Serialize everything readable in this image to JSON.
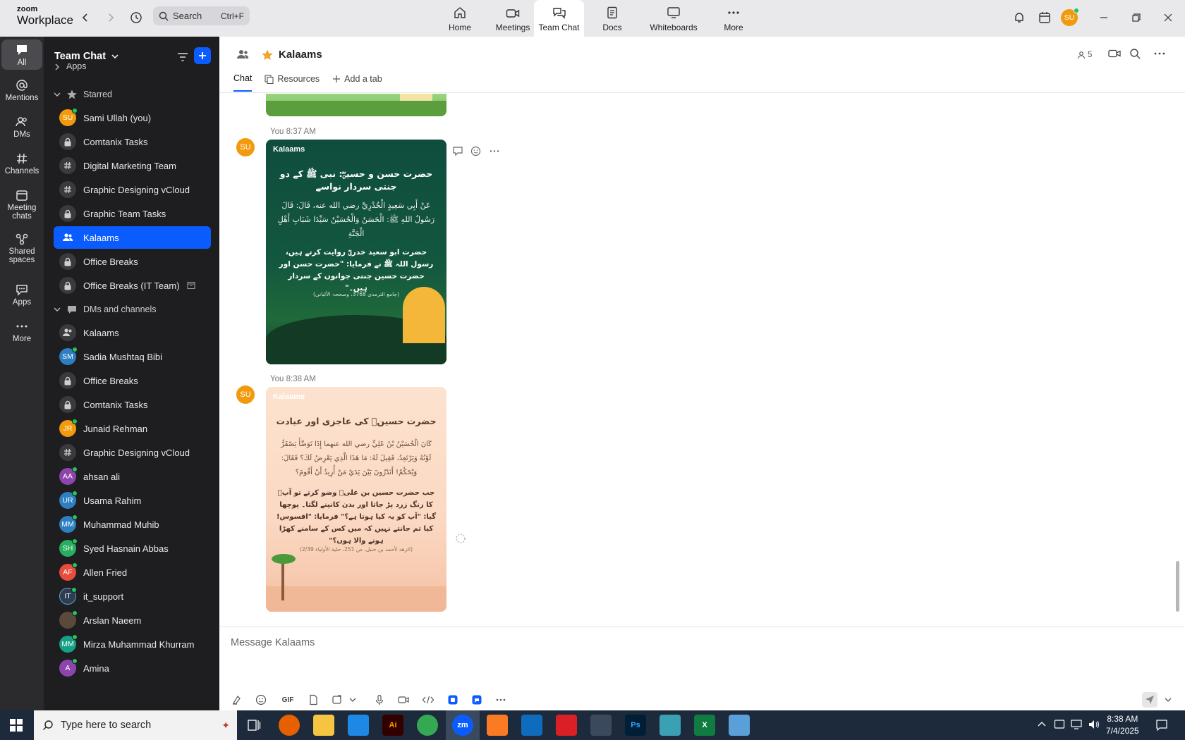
{
  "app": {
    "logo_line1": "zoom",
    "logo_line2": "Workplace"
  },
  "search": {
    "placeholder": "Search",
    "shortcut": "Ctrl+F"
  },
  "nav_tabs": [
    {
      "label": "Home",
      "icon": "home-icon"
    },
    {
      "label": "Meetings",
      "icon": "video-icon"
    },
    {
      "label": "Team Chat",
      "icon": "chat-icon",
      "active": true
    },
    {
      "label": "Docs",
      "icon": "doc-icon"
    },
    {
      "label": "Whiteboards",
      "icon": "whiteboard-icon"
    },
    {
      "label": "More",
      "icon": "more-icon"
    }
  ],
  "user": {
    "initials": "SU"
  },
  "rail": [
    {
      "label": "All",
      "icon": "chat-bubble-icon",
      "active": true
    },
    {
      "label": "Mentions",
      "icon": "at-icon"
    },
    {
      "label": "DMs",
      "icon": "people-icon"
    },
    {
      "label": "Channels",
      "icon": "hash-icon"
    },
    {
      "label": "Meeting chats",
      "icon": "calendar-icon"
    },
    {
      "label": "Shared spaces",
      "icon": "shared-icon"
    },
    {
      "label": "Apps",
      "icon": "apps-icon"
    },
    {
      "label": "More",
      "icon": "more-icon"
    }
  ],
  "sidebar": {
    "title": "Team Chat",
    "apps_label": "Apps",
    "starred_label": "Starred",
    "dms_label": "DMs and channels",
    "starred": [
      {
        "name": "Sami Ullah (you)",
        "type": "avatar",
        "initials": "SU",
        "color": "#f29a0d",
        "online": true
      },
      {
        "name": "Comtanix Tasks",
        "type": "lock"
      },
      {
        "name": "Digital Marketing Team",
        "type": "hash"
      },
      {
        "name": "Graphic Designing vCloud",
        "type": "hash"
      },
      {
        "name": "Graphic Team Tasks",
        "type": "lock"
      },
      {
        "name": "Kalaams",
        "type": "group",
        "active": true
      },
      {
        "name": "Office Breaks",
        "type": "lock"
      },
      {
        "name": "Office Breaks (IT Team)",
        "type": "lock",
        "archived": true
      }
    ],
    "dms": [
      {
        "name": "Kalaams",
        "type": "group"
      },
      {
        "name": "Sadia Mushtaq Bibi",
        "type": "avatar",
        "initials": "SM",
        "color": "#2d7fc1",
        "online": true
      },
      {
        "name": "Office Breaks",
        "type": "lock"
      },
      {
        "name": "Comtanix Tasks",
        "type": "lock"
      },
      {
        "name": "Junaid Rehman",
        "type": "avatar",
        "initials": "JR",
        "color": "#f29a0d",
        "online": true
      },
      {
        "name": "Graphic Designing vCloud",
        "type": "hash"
      },
      {
        "name": "ahsan ali",
        "type": "avatar",
        "initials": "AA",
        "color": "#8e44ad",
        "online": true
      },
      {
        "name": "Usama Rahim",
        "type": "avatar",
        "initials": "UR",
        "color": "#2d7fc1",
        "online": true
      },
      {
        "name": "Muhammad Muhib",
        "type": "avatar",
        "initials": "MM",
        "color": "#2d7fc1",
        "online": true
      },
      {
        "name": "Syed Hasnain Abbas",
        "type": "avatar",
        "initials": "SH",
        "color": "#27ae60",
        "online": true
      },
      {
        "name": "Allen Fried",
        "type": "avatar",
        "initials": "AF",
        "color": "#e74c3c",
        "online": true
      },
      {
        "name": "it_support",
        "type": "avatar",
        "initials": "IT",
        "color": "#2c3e50",
        "online": true
      },
      {
        "name": "Arslan Naeem",
        "type": "avatar",
        "initials": "",
        "color": "#5a4a3a",
        "online": true
      },
      {
        "name": "Mirza Muhammad Khurram",
        "type": "avatar",
        "initials": "MM",
        "color": "#16a085",
        "online": true
      },
      {
        "name": "Amina",
        "type": "avatar",
        "initials": "A",
        "color": "#8e44ad",
        "online": true
      }
    ]
  },
  "channel": {
    "title": "Kalaams",
    "member_count": "5",
    "tabs": [
      "Chat",
      "Resources",
      "Add a tab"
    ]
  },
  "messages": [
    {
      "meta": "You 8:37 AM",
      "avatar": "SU",
      "card": {
        "brand": "Kalaams",
        "title": "حضرت حسن و حسینؓ: نبی ﷺ کے دو جنتی سردار نواسے",
        "arabic": "عَنْ أَبِي سَعِيدٍ الْخُدْرِيِّ رضي الله عنه، قَالَ: قَالَ رَسُولُ اللهِ ﷺ: الْحَسَنُ وَالْحُسَيْنُ سَيِّدَا شَبَابِ أَهْلِ الْجَنَّةِ",
        "urdu": "حضرت ابو سعید خدریؓ روایت کرتے ہیں، رسول اللہ ﷺ نے فرمایا: \"حضرت حسن اور حضرت حسین جنتی جوانوں کے سردار ہیں۔\"",
        "source": "(جامع الترمذی 3768، وصححہ الألبانی)"
      }
    },
    {
      "meta": "You 8:38 AM",
      "avatar": "SU",
      "card": {
        "brand": "Kalaams",
        "title": "حضرت حسینؓ کی عاجزی اور عبادت",
        "arabic": "كَانَ الْحُسَيْنُ بْنُ عَلِيٍّ رضي الله عنهما إِذَا تَوَضَّأَ يَصْفَرُّ لَوْنُهُ وَيَرْتَعِدُ، فَقِيلَ لَهُ: مَا هَذَا الَّذِي يَعْرِضُ لَكَ؟ فَقَالَ: وَيْحَكُمْ! أَتَدْرُونَ بَيْنَ يَدَيْ مَنْ أُرِيدُ أَنْ أَقُومَ؟",
        "urdu": "جب حضرت حسین بن علیؓ وضو کرتے تو آپؓ کا رنگ زرد پڑ جاتا اور بدن کانپنے لگتا۔ پوچھا گیا: \"آپ کو یہ کیا ہوتا ہے؟\" فرمایا: \"افسوس! کیا تم جانتے نہیں کہ میں کس کے سامنے کھڑا ہونے والا ہوں؟\"",
        "source": "(الزهد لأحمد بن حنبل، ص 251، حلية الأولياء 2/39)"
      }
    }
  ],
  "composer": {
    "placeholder": "Message Kalaams",
    "gif_label": "GIF"
  },
  "taskbar": {
    "search_placeholder": "Type here to search",
    "time": "8:38 AM",
    "date": "7/4/2025",
    "apps": [
      {
        "name": "firefox-app",
        "label": "",
        "color": "#e66000"
      },
      {
        "name": "explorer-app",
        "label": "",
        "color": "#f5c542"
      },
      {
        "name": "vscode-app",
        "label": "",
        "color": "#1e88e5"
      },
      {
        "name": "illustrator-app",
        "label": "Ai",
        "color": "#330000"
      },
      {
        "name": "chrome-app",
        "label": "",
        "color": "#34a853"
      },
      {
        "name": "zoom-app",
        "label": "zm",
        "color": "#0b5cff"
      },
      {
        "name": "xampp-app",
        "label": "",
        "color": "#fb7a24"
      },
      {
        "name": "outlook-app",
        "label": "",
        "color": "#0f6cbd"
      },
      {
        "name": "creative-cloud-app",
        "label": "",
        "color": "#da1f26"
      },
      {
        "name": "pen-app",
        "label": "",
        "color": "#3a4a5c"
      },
      {
        "name": "photoshop-app",
        "label": "Ps",
        "color": "#001e36"
      },
      {
        "name": "gem-app",
        "label": "",
        "color": "#3aa0b4"
      },
      {
        "name": "excel-app",
        "label": "X",
        "color": "#107c41"
      },
      {
        "name": "notepad-app",
        "label": "",
        "color": "#5aa0d8"
      }
    ]
  }
}
